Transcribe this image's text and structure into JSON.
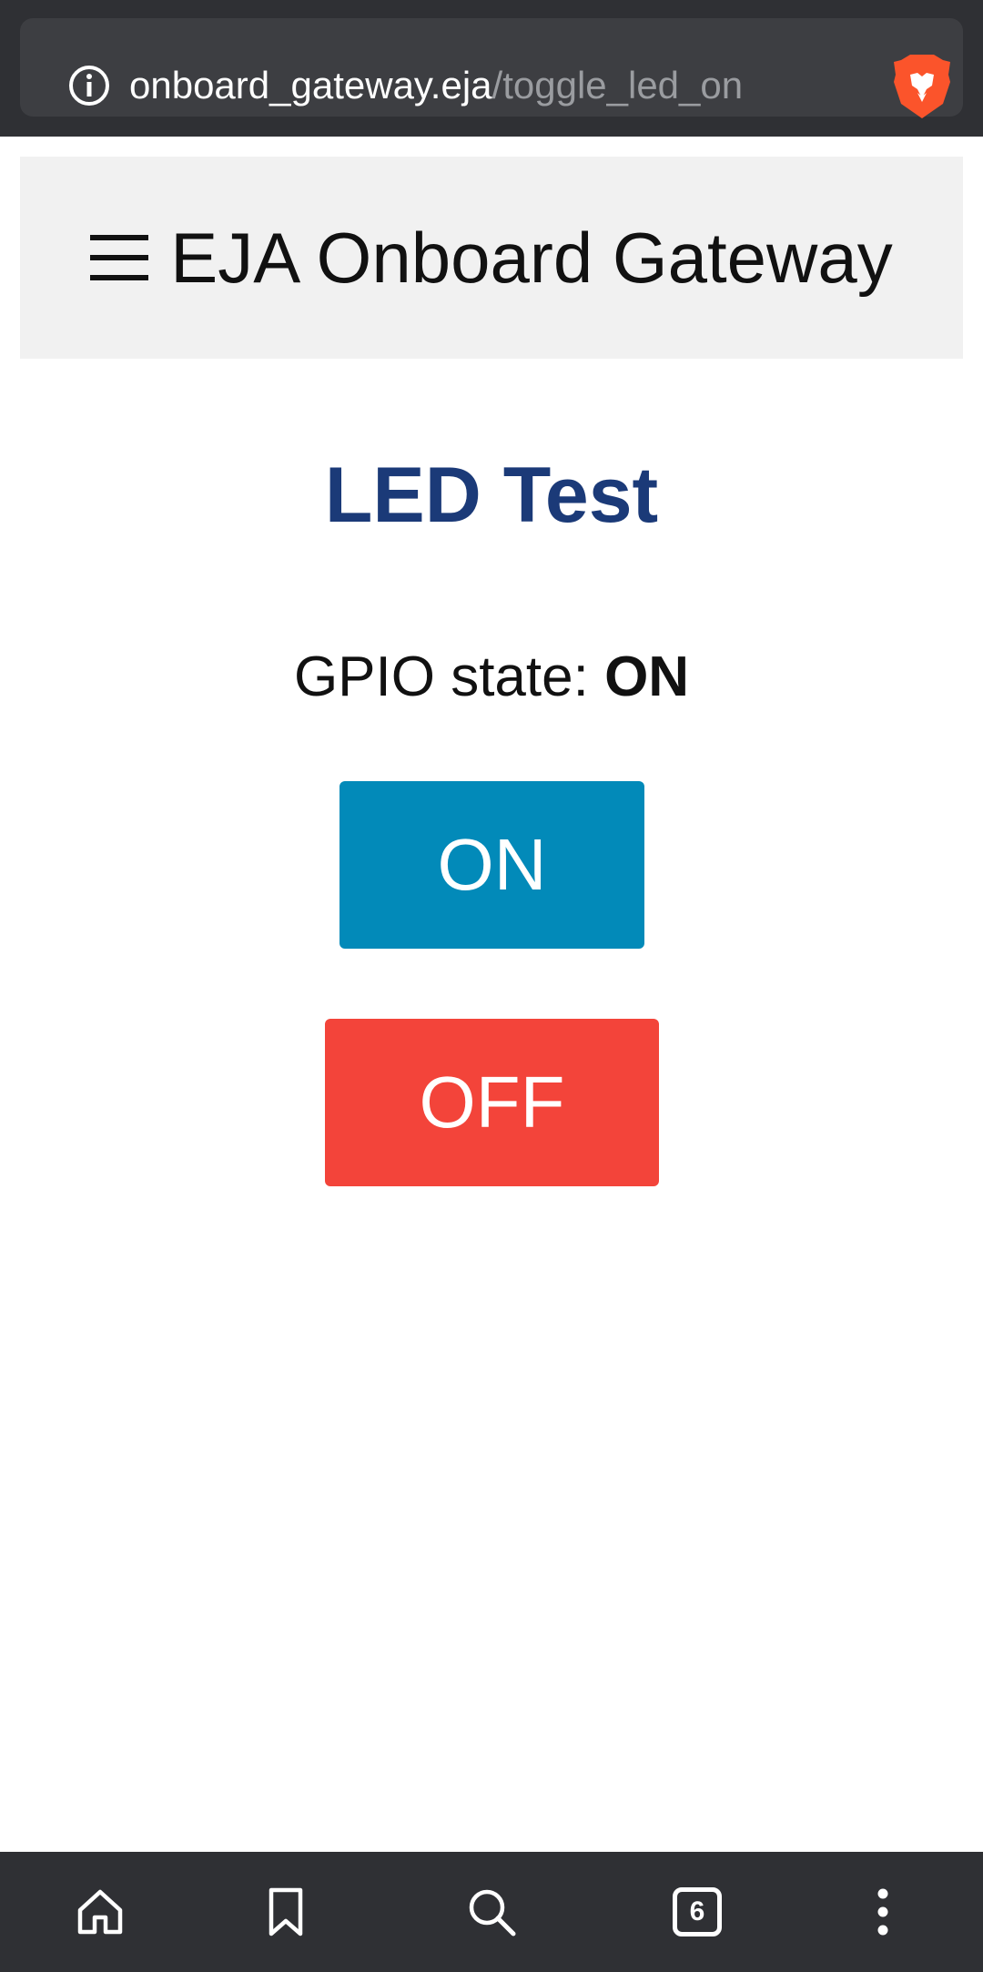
{
  "browser": {
    "url_host": "onboard_gateway.eja",
    "url_path": "/toggle_led_on",
    "tab_count": "6"
  },
  "header": {
    "menu_glyph": "☰",
    "title": "EJA Onboard Gateway"
  },
  "main": {
    "heading": "LED Test",
    "gpio_label": "GPIO state: ",
    "gpio_value": "ON",
    "on_button": "ON",
    "off_button": "OFF"
  },
  "colors": {
    "heading": "#1b3a78",
    "on_button": "#028ab9",
    "off_button": "#f3443a",
    "browser_chrome": "#2f3034"
  },
  "icons": {
    "info": "info-icon",
    "brave": "brave-lion-icon",
    "menu": "hamburger-menu-icon",
    "home": "home-icon",
    "bookmark": "bookmark-icon",
    "search": "search-icon",
    "tabs": "tabs-icon",
    "more": "more-vertical-icon"
  }
}
